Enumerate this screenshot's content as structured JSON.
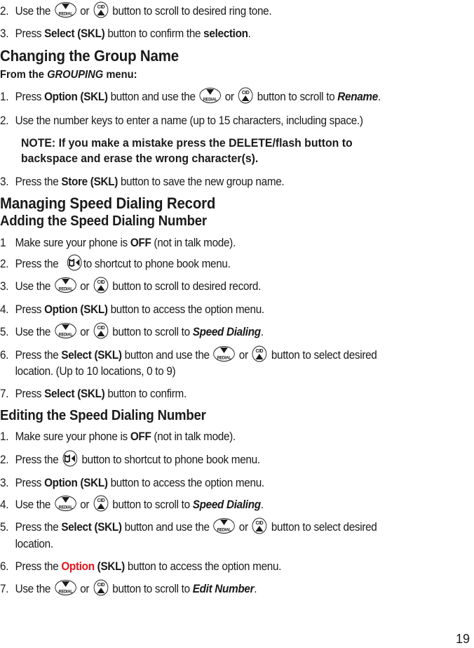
{
  "page_number": "19",
  "icons": {
    "redial": {
      "name": "redial-down-button",
      "label": "REDIAL"
    },
    "cid": {
      "name": "cid-up-button",
      "label": "CID"
    },
    "phonebook": {
      "name": "phonebook-button"
    }
  },
  "top_steps": [
    {
      "num": "2.",
      "pre": "Use the",
      "mid": "or",
      "post": "button to scroll to desired ring tone."
    },
    {
      "num": "3.",
      "pre": "Press",
      "bold": "Select (SKL)",
      "mid": "button to confirm the",
      "bold2": "selection",
      "post": "."
    }
  ],
  "section_group": {
    "heading": "Changing the Group Name",
    "sub_pre": "From the",
    "sub_italic": "GROUPING",
    "sub_post": "menu:",
    "steps": [
      {
        "num": "1.",
        "pre": "Press",
        "bold": "Option (SKL)",
        "mid": "button and use the",
        "or": "or",
        "post": "button to scroll to",
        "target": "Rename",
        "end": "."
      },
      {
        "num": "2.",
        "text": "Use the number keys to enter a name (up to 15 characters, including space.)"
      },
      {
        "num": "3.",
        "pre": "Press the",
        "bold": "Store (SKL)",
        "post": "button to save the new group name."
      }
    ],
    "note_line1": "NOTE: If you make a mistake press the DELETE/flash button to",
    "note_line2": "backspace and erase the wrong character(s)."
  },
  "section_speed": {
    "heading": "Managing Speed Dialing Record",
    "add": {
      "heading": "Adding the Speed Dialing Number",
      "steps": [
        {
          "num": "1",
          "pre": "Make sure your phone is",
          "bold": "OFF",
          "post": "(not in talk mode)."
        },
        {
          "num": "2.",
          "pre": "Press the",
          "post": "to shortcut to phone book menu."
        },
        {
          "num": "3.",
          "pre": "Use the",
          "or": "or",
          "post": "button to scroll to desired record."
        },
        {
          "num": "4.",
          "pre": "Press",
          "bold": "Option (SKL)",
          "post": "button to access the option menu."
        },
        {
          "num": "5.",
          "pre": "Use the",
          "or": "or",
          "post": "button to scroll to",
          "target": "Speed Dialing",
          "end": "."
        },
        {
          "num": "6.",
          "pre": "Press the",
          "bold": "Select (SKL)",
          "mid": "button and use the",
          "or": "or",
          "post": "button to select desired",
          "cont": "location. (Up to 10 locations, 0 to 9)"
        },
        {
          "num": "7.",
          "pre": "Press",
          "bold": "Select (SKL)",
          "post": "button to confirm."
        }
      ]
    },
    "edit": {
      "heading": "Editing the Speed Dialing Number",
      "steps": [
        {
          "num": "1.",
          "pre": "Make sure your phone is",
          "bold": "OFF",
          "post": "(not in talk mode)."
        },
        {
          "num": "2.",
          "pre": "Press the",
          "post": "button to shortcut to phone book menu."
        },
        {
          "num": "3.",
          "pre": "Press",
          "bold": "Option (SKL)",
          "post": "button to access the option menu."
        },
        {
          "num": "4.",
          "pre": "Use the",
          "or": "or",
          "post": "button to scroll to",
          "target": "Speed Dialing",
          "end": "."
        },
        {
          "num": "5.",
          "pre": "Press the",
          "bold": "Select (SKL)",
          "mid": "button and use the",
          "or": "or",
          "post": "button to select desired",
          "cont": "location."
        },
        {
          "num": "6.",
          "pre": "Press the",
          "red": "Option",
          "bold": "(SKL)",
          "post": "button to access the option menu."
        },
        {
          "num": "7.",
          "pre": "Use the",
          "or": "or",
          "post": "button to scroll to",
          "target": "Edit Number",
          "end": "."
        }
      ]
    }
  },
  "colors": {
    "text": "#1a1a1a",
    "accent_red": "#e5131d"
  }
}
